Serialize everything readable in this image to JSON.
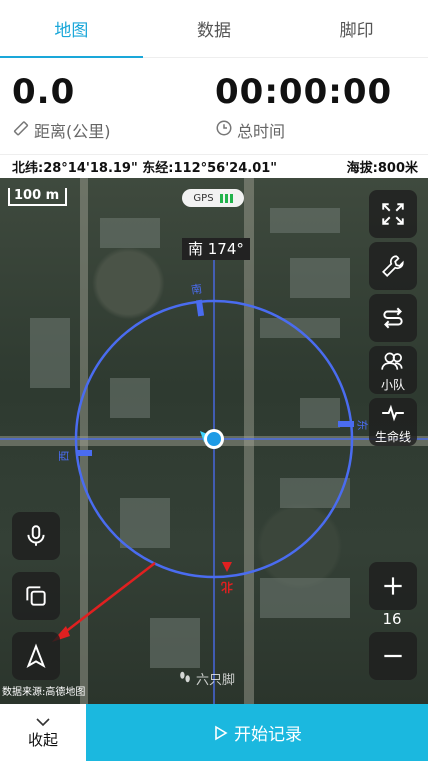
{
  "tabs": [
    {
      "label": "地图",
      "active": true
    },
    {
      "label": "数据",
      "active": false
    },
    {
      "label": "脚印",
      "active": false
    }
  ],
  "stats": {
    "distance_value": "0.0",
    "distance_label": "距离(公里)",
    "duration_value": "00:00:00",
    "duration_label": "总时间"
  },
  "coords": {
    "lat_lon": "北纬:28°14'18.19\" 东经:112°56'24.01\"",
    "altitude": "海拔:800米"
  },
  "map": {
    "scale_label": "100 m",
    "gps_label": "GPS",
    "heading_label": "南 174°",
    "team_label": "小队",
    "lifeline_label": "生命线",
    "zoom_level": "16",
    "watermark_label": "六只脚",
    "source_label": "数据来源:高德地图",
    "compass_labels": {
      "south": "南",
      "north": "北",
      "east": "东",
      "west": "西"
    },
    "compass_color": "#4a6cf0",
    "north_color": "#e02020"
  },
  "bottom": {
    "collapse_label": "收起",
    "start_label": "开始记录"
  },
  "colors": {
    "accent": "#1aa7d9",
    "start_button": "#1bb8df"
  }
}
